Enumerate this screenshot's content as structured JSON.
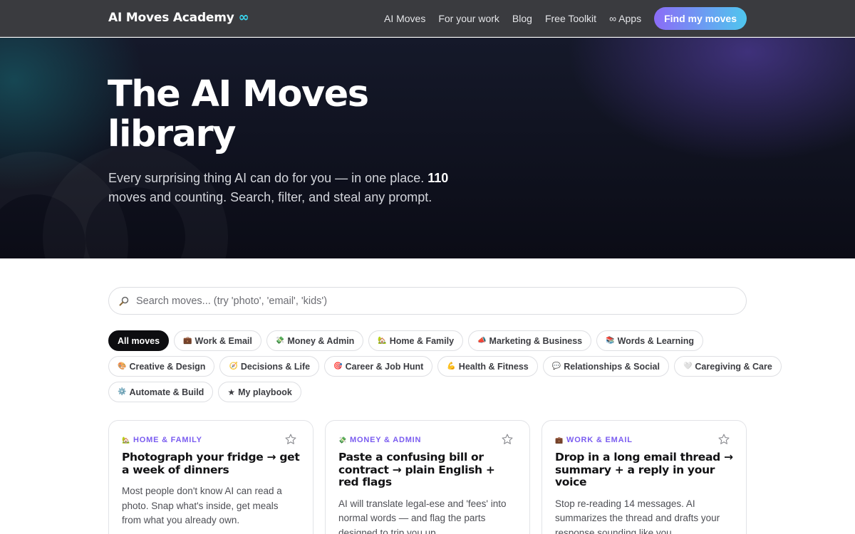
{
  "nav": {
    "brand": "AI Moves Academy",
    "brand_symbol": "∞",
    "links": [
      "AI Moves",
      "For your work",
      "Blog",
      "Free Toolkit",
      "∞ Apps"
    ],
    "cta": "Find my moves"
  },
  "hero": {
    "title_line1": "The AI Moves",
    "title_line2": "library",
    "subtitle_pre": "Every surprising thing AI can do for you — in one place.",
    "subtitle_count": "110",
    "subtitle_post": "moves and counting. Search, filter, and steal any prompt."
  },
  "search": {
    "placeholder": "Search moves... (try 'photo', 'email', 'kids')",
    "value": ""
  },
  "filters": {
    "row1": [
      {
        "label": "All moves",
        "emoji": ""
      },
      {
        "label": "Work & Email",
        "emoji": "💼"
      },
      {
        "label": "Money & Admin",
        "emoji": "💸"
      },
      {
        "label": "Home & Family",
        "emoji": "🏡"
      },
      {
        "label": "Marketing & Business",
        "emoji": "📣"
      },
      {
        "label": "Words & Learning",
        "emoji": "📚"
      }
    ],
    "row2": [
      {
        "label": "Creative & Design",
        "emoji": "🎨"
      },
      {
        "label": "Decisions & Life",
        "emoji": "🧭"
      },
      {
        "label": "Career & Job Hunt",
        "emoji": "🎯"
      },
      {
        "label": "Health & Fitness",
        "emoji": "💪"
      },
      {
        "label": "Relationships & Social",
        "emoji": "💬"
      },
      {
        "label": "Caregiving & Care",
        "emoji": "🤍"
      }
    ],
    "row3": [
      {
        "label": "Automate & Build",
        "emoji": "⚙️"
      },
      {
        "label": "My playbook",
        "emoji": "★"
      }
    ],
    "active": "All moves"
  },
  "cards": [
    {
      "category": "HOME & FAMILY",
      "emoji": "🏡",
      "title": "Photograph your fridge → get a week of dinners",
      "description": "Most people don't know AI can read a photo. Snap what's inside, get meals from what you already own."
    },
    {
      "category": "MONEY & ADMIN",
      "emoji": "💸",
      "title": "Paste a confusing bill or contract → plain English + red flags",
      "description": "AI will translate legal-ese and 'fees' into normal words — and flag the parts designed to trip you up."
    },
    {
      "category": "WORK & EMAIL",
      "emoji": "💼",
      "title": "Drop in a long email thread → summary + a reply in your voice",
      "description": "Stop re-reading 14 messages. AI summarizes the thread and drafts your response sounding like you."
    }
  ],
  "colors": {
    "accent_purple": "#7a5cf0",
    "brand_cyan": "#38d6ee",
    "nav_bg": "#3a3b3f",
    "hero_bg": "#0b0c16"
  }
}
